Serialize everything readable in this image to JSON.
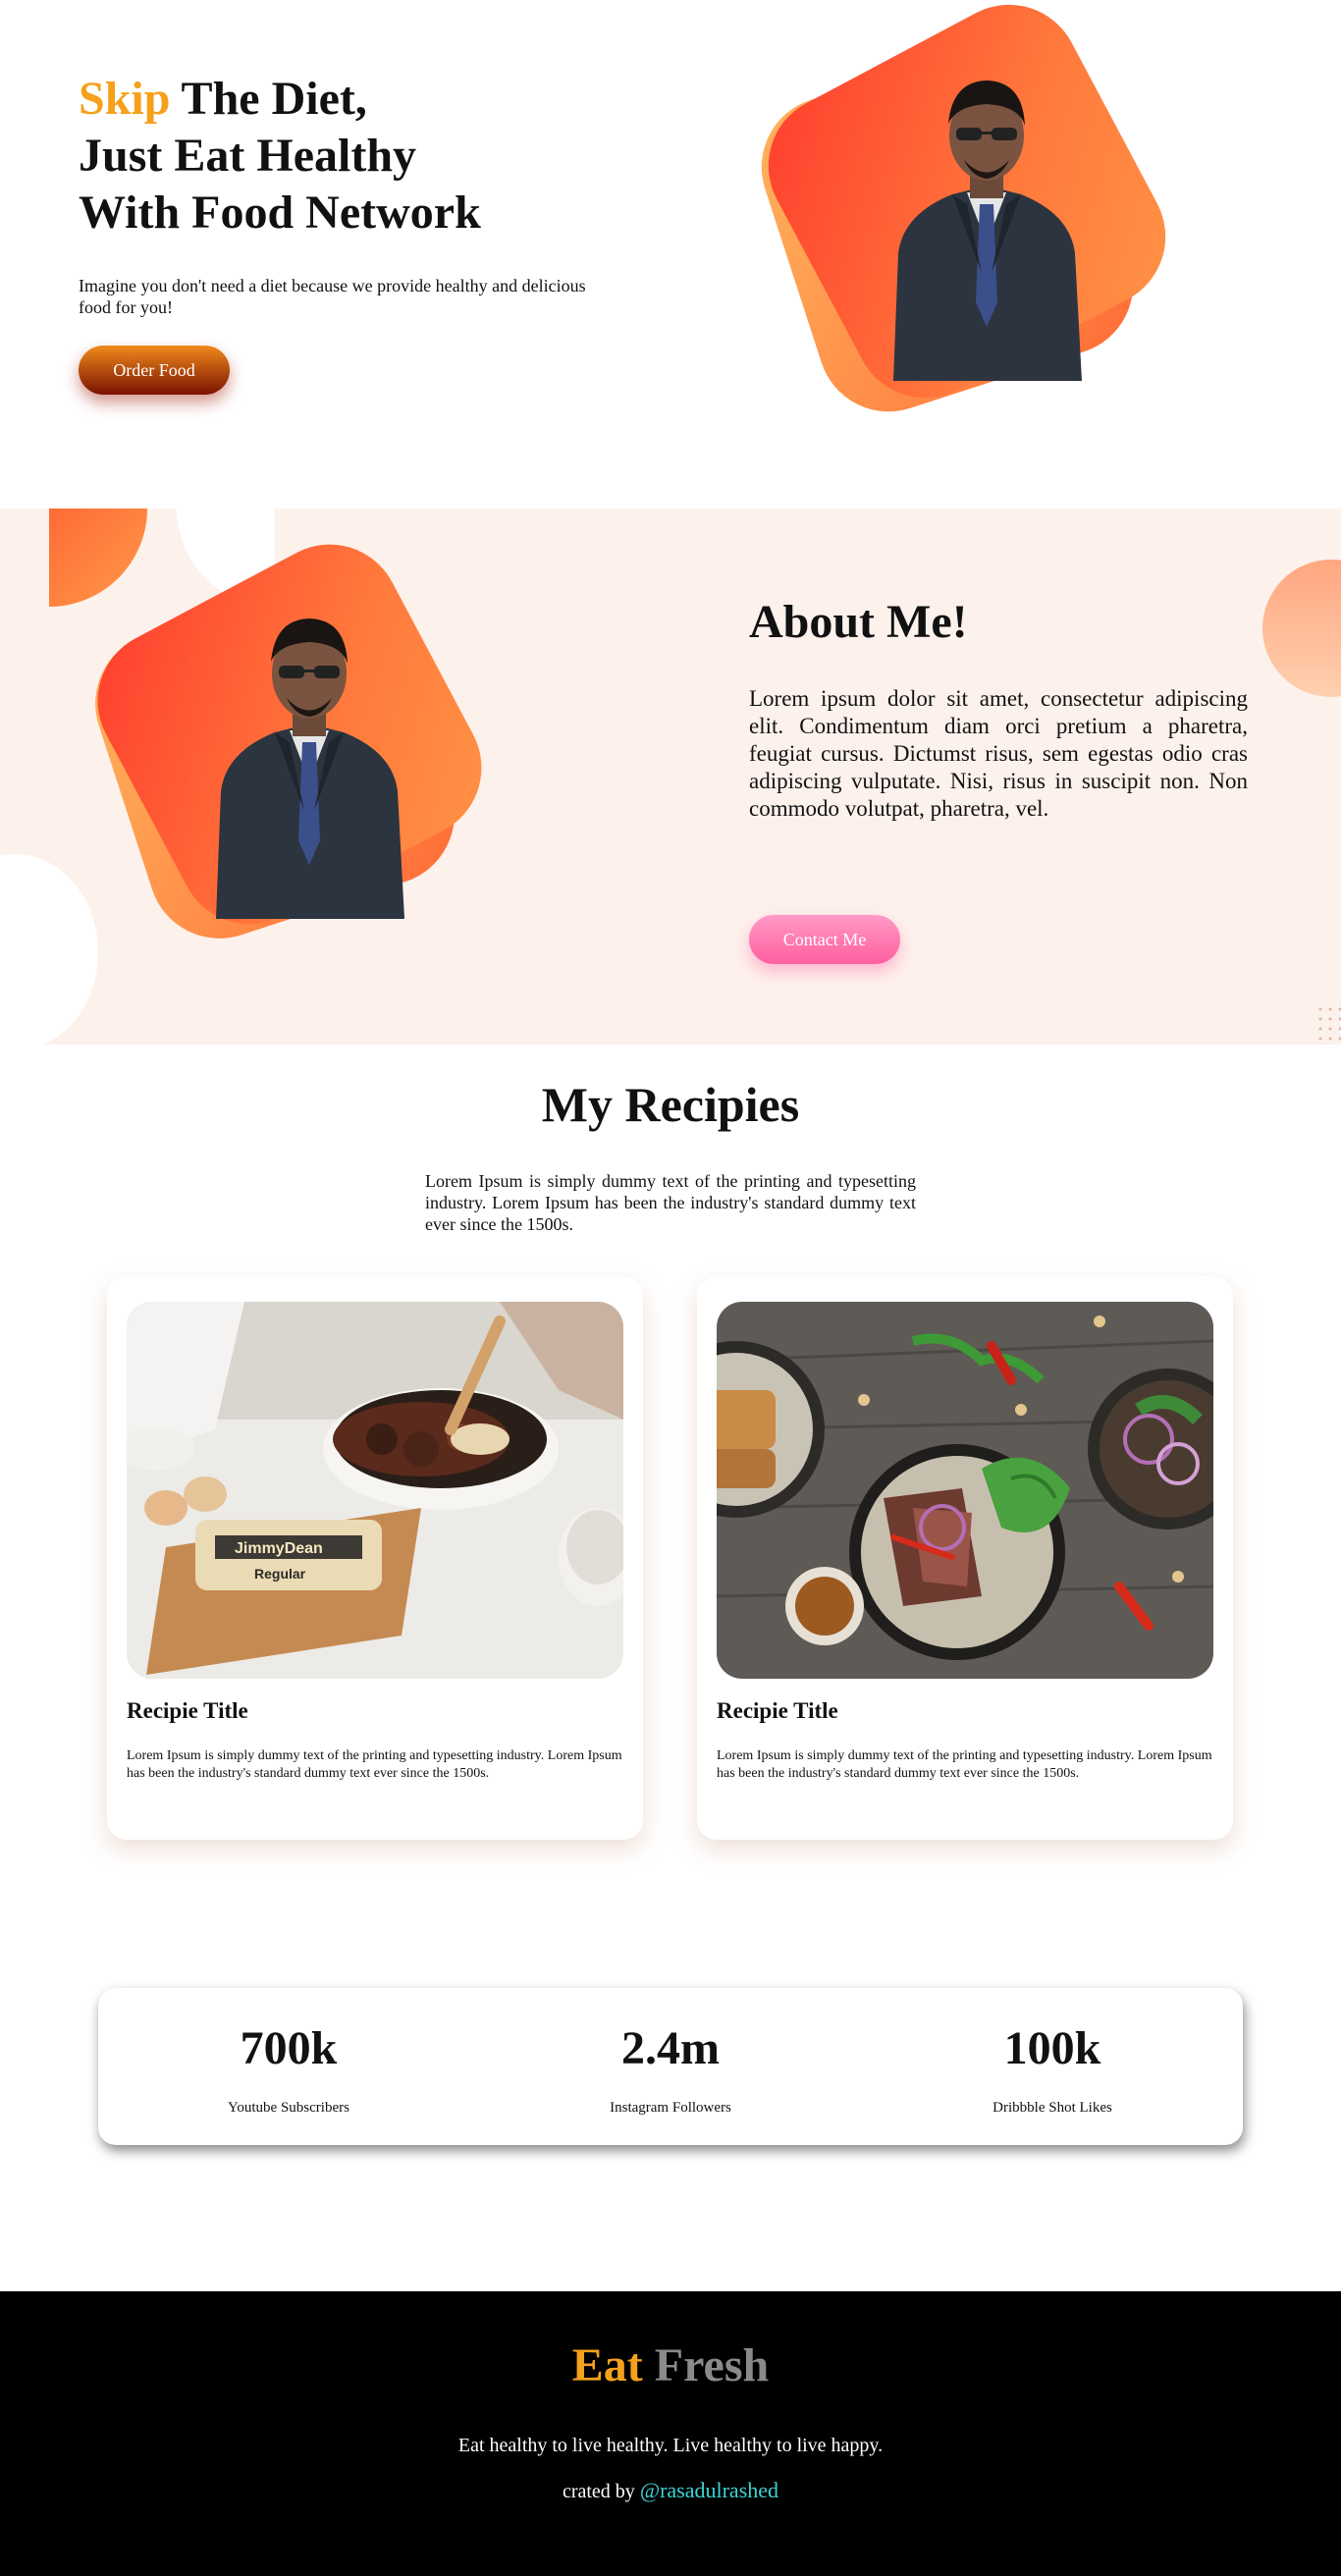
{
  "hero": {
    "title_accent": "Skip",
    "title_line1_rest": " The Diet,",
    "title_line2": "Just Eat Healthy",
    "title_line3": "With Food Network",
    "subtitle": "Imagine you don't need a diet because we provide healthy and delicious food for you!",
    "button_label": "Order Food"
  },
  "about": {
    "title": "About Me!",
    "text": "Lorem ipsum dolor sit amet, consectetur adipiscing elit. Condimentum diam orci pretium a pharetra, feugiat cursus. Dictumst risus, sem egestas odio cras adipiscing vulputate. Nisi, risus in suscipit non. Non commodo volutpat, pharetra, vel.",
    "button_label": "Contact Me"
  },
  "recipes": {
    "title": "My Recipies",
    "intro": "Lorem Ipsum is simply dummy text of the printing and typesetting industry. Lorem Ipsum has been the industry's standard dummy text ever since the 1500s.",
    "cards": [
      {
        "title": "Recipie Title",
        "text": "Lorem Ipsum is simply dummy text of the printing and typesetting industry. Lorem Ipsum has been the industry's standard dummy text ever since the 1500s."
      },
      {
        "title": "Recipie Title",
        "text": "Lorem Ipsum is simply dummy text of the printing and typesetting industry. Lorem Ipsum has been the industry's standard dummy text ever since the 1500s."
      }
    ]
  },
  "stats": [
    {
      "value": "700k",
      "label": "Youtube Subscribers"
    },
    {
      "value": "2.4m",
      "label": "Instagram Followers"
    },
    {
      "value": "100k",
      "label": "Dribbble Shot Likes"
    }
  ],
  "footer": {
    "brand_word1": "Eat",
    "brand_word2": "Fresh",
    "tagline": "Eat healthy to live healthy. Live healthy to live happy.",
    "credit_prefix": "crated by ",
    "credit_handle": "@rasadulrashed"
  },
  "colors": {
    "accent": "#f5a11c",
    "blob_orange": "#ff6c36",
    "about_bg": "#fdf1ec",
    "contact_pink": "#ff6fa8",
    "footer_link": "#3dd5d5"
  },
  "icons": [
    "person-photo",
    "food-photo-breakfast",
    "food-photo-steak-salad"
  ]
}
